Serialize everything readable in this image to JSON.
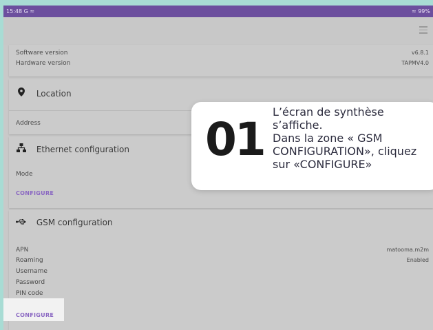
{
  "status_bar": {
    "time": "15:48",
    "icons_left": "G ≈",
    "battery": "≈ 99%"
  },
  "software": {
    "software_version_label": "Software version",
    "software_version_value": "v6.8.1",
    "hardware_version_label": "Hardware version",
    "hardware_version_value": "TAPMV4.0"
  },
  "location": {
    "title": "Location",
    "address_label": "Address"
  },
  "ethernet": {
    "title": "Ethernet configuration",
    "mode_label": "Mode",
    "configure_label": "CONFIGURE"
  },
  "gsm": {
    "title": "GSM configuration",
    "fields": [
      {
        "label": "APN",
        "value": "matooma.m2m"
      },
      {
        "label": "Roaming",
        "value": "Enabled"
      },
      {
        "label": "Username",
        "value": ""
      },
      {
        "label": "Password",
        "value": ""
      },
      {
        "label": "PIN code",
        "value": ""
      }
    ],
    "configure_label": "CONFIGURE"
  },
  "callout": {
    "number": "01",
    "line1": "L’écran de synthèse",
    "line2": "s’affiche.",
    "line3": "Dans la zone « GSM",
    "line4": "CONFIGURATION», cliquez",
    "line5": "sur «CONFIGURE»"
  },
  "colors": {
    "status_bar": "#6c4f9e",
    "accent": "#8a67c2",
    "background": "#a8dcd4"
  },
  "icons": {
    "menu": "hamburger-menu-icon",
    "location": "location-pin-icon",
    "ethernet": "ethernet-icon",
    "gsm": "usb-icon"
  }
}
